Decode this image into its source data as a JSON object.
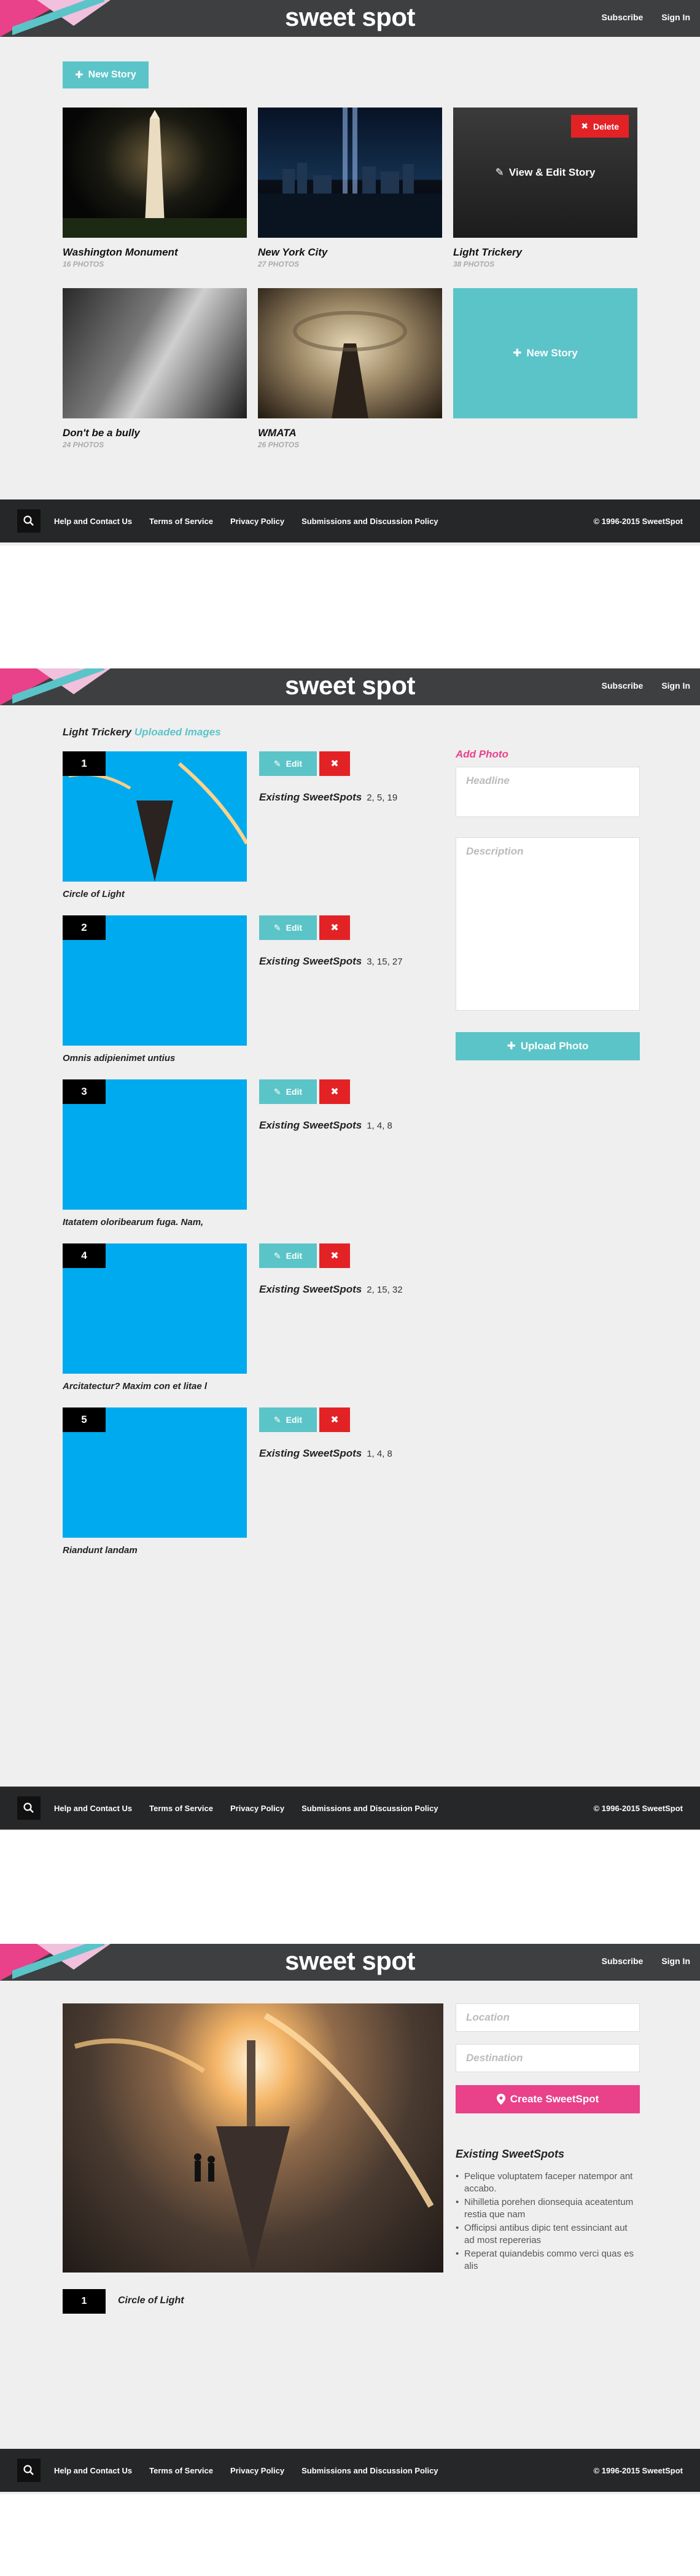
{
  "header": {
    "logo": "sweet spot",
    "subscribe": "Subscribe",
    "sign_in": "Sign In"
  },
  "footer": {
    "links": [
      "Help and Contact Us",
      "Terms of Service",
      "Privacy Policy",
      "Submissions and Discussion Policy"
    ],
    "copyright": "© 1996-2015 SweetSpot"
  },
  "stories": {
    "new_story_label": "New Story",
    "delete_label": "Delete",
    "view_edit_label": "View & Edit Story",
    "items": [
      {
        "title": "Washington Monument",
        "count": "16 PHOTOS"
      },
      {
        "title": "New York City",
        "count": "27 PHOTOS"
      },
      {
        "title": "Light Trickery",
        "count": "38 PHOTOS"
      },
      {
        "title": "Don't be a bully",
        "count": "24 PHOTOS"
      },
      {
        "title": "WMATA",
        "count": "26 PHOTOS"
      }
    ]
  },
  "uploads": {
    "story_title": "Light Trickery",
    "section_label": "Uploaded Images",
    "edit_label": "Edit",
    "existing_label": "Existing SweetSpots",
    "rows": [
      {
        "num": "1",
        "caption": "Circle of Light",
        "spots": "2, 5, 19"
      },
      {
        "num": "2",
        "caption": "Omnis adipienimet untius",
        "spots": "3, 15, 27"
      },
      {
        "num": "3",
        "caption": "Itatatem oloribearum fuga. Nam,",
        "spots": "1, 4, 8"
      },
      {
        "num": "4",
        "caption": "Arcitatectur? Maxim con et litae l",
        "spots": "2, 15, 32"
      },
      {
        "num": "5",
        "caption": "Riandunt landam",
        "spots": "1, 4, 8"
      }
    ],
    "add_photo": "Add Photo",
    "headline_placeholder": "Headline",
    "description_placeholder": "Description",
    "upload_label": "Upload Photo"
  },
  "spot": {
    "location_placeholder": "Location",
    "destination_placeholder": "Destination",
    "create_label": "Create SweetSpot",
    "existing_title": "Existing SweetSpots",
    "existing": [
      "Pelique voluptatem faceper natempor ant accabo.",
      "Nihilletia porehen dionsequia aceatentum restia que nam",
      "Officipsi antibus dipic tent essinciant aut ad most repererias",
      "Reperat quiandebis commo verci quas es alis"
    ],
    "photo_num": "1",
    "photo_caption": "Circle of Light"
  },
  "colors": {
    "teal": "#5bc4c8",
    "pink": "#e9418a",
    "red": "#e32226",
    "blue": "#00aaee",
    "dark": "#3d3f40"
  }
}
